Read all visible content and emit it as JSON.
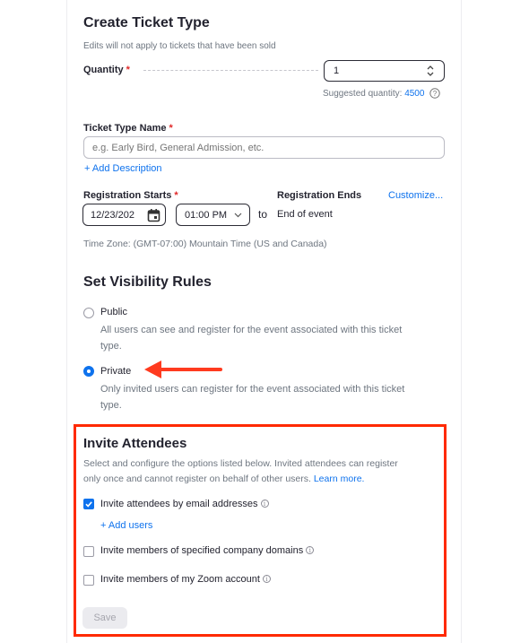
{
  "header": {
    "title": "Create Ticket Type",
    "subtitle": "Edits will not apply to tickets that have been sold"
  },
  "quantity": {
    "label": "Quantity",
    "required_mark": "*",
    "value": "1",
    "suggested_prefix": "Suggested quantity:",
    "suggested_value": "4500",
    "help_icon": "question-icon"
  },
  "ticket_name": {
    "label": "Ticket Type Name",
    "required_mark": "*",
    "placeholder": "e.g. Early Bird, General Admission, etc.",
    "add_description": "+ Add Description"
  },
  "registration": {
    "starts_label": "Registration Starts",
    "required_mark": "*",
    "start_date": "12/23/202",
    "start_time": "01:00 PM",
    "to_text": "to",
    "ends_label": "Registration Ends",
    "ends_value": "End of event",
    "customize_link": "Customize...",
    "timezone": "Time Zone: (GMT-07:00) Mountain Time (US and Canada)",
    "calendar_icon": "calendar-icon",
    "chevron_icon": "chevron-down-icon"
  },
  "visibility": {
    "title": "Set Visibility Rules",
    "options": [
      {
        "label": "Public",
        "desc_line1": "All users can see and register for the event associated with this ticket",
        "desc_line2": "type.",
        "selected": false
      },
      {
        "label": "Private",
        "desc_line1": "Only invited users can register for the event associated with this ticket",
        "desc_line2": "type.",
        "selected": true
      }
    ]
  },
  "invite": {
    "title": "Invite Attendees",
    "desc_line1": "Select and configure the options listed below. Invited attendees can register",
    "desc_line2": "only once and cannot register on behalf of other users.",
    "learn_more": "Learn more.",
    "options": [
      {
        "label": "Invite attendees by email addresses",
        "checked": true
      },
      {
        "label": "Invite members of specified company domains",
        "checked": false
      },
      {
        "label": "Invite members of my Zoom account",
        "checked": false
      }
    ],
    "add_users": "+ Add users",
    "info_icon": "i",
    "save_label": "Save"
  },
  "annotations": {
    "arrow_color": "#ff3b1f",
    "highlight_color": "#ff2a00"
  }
}
